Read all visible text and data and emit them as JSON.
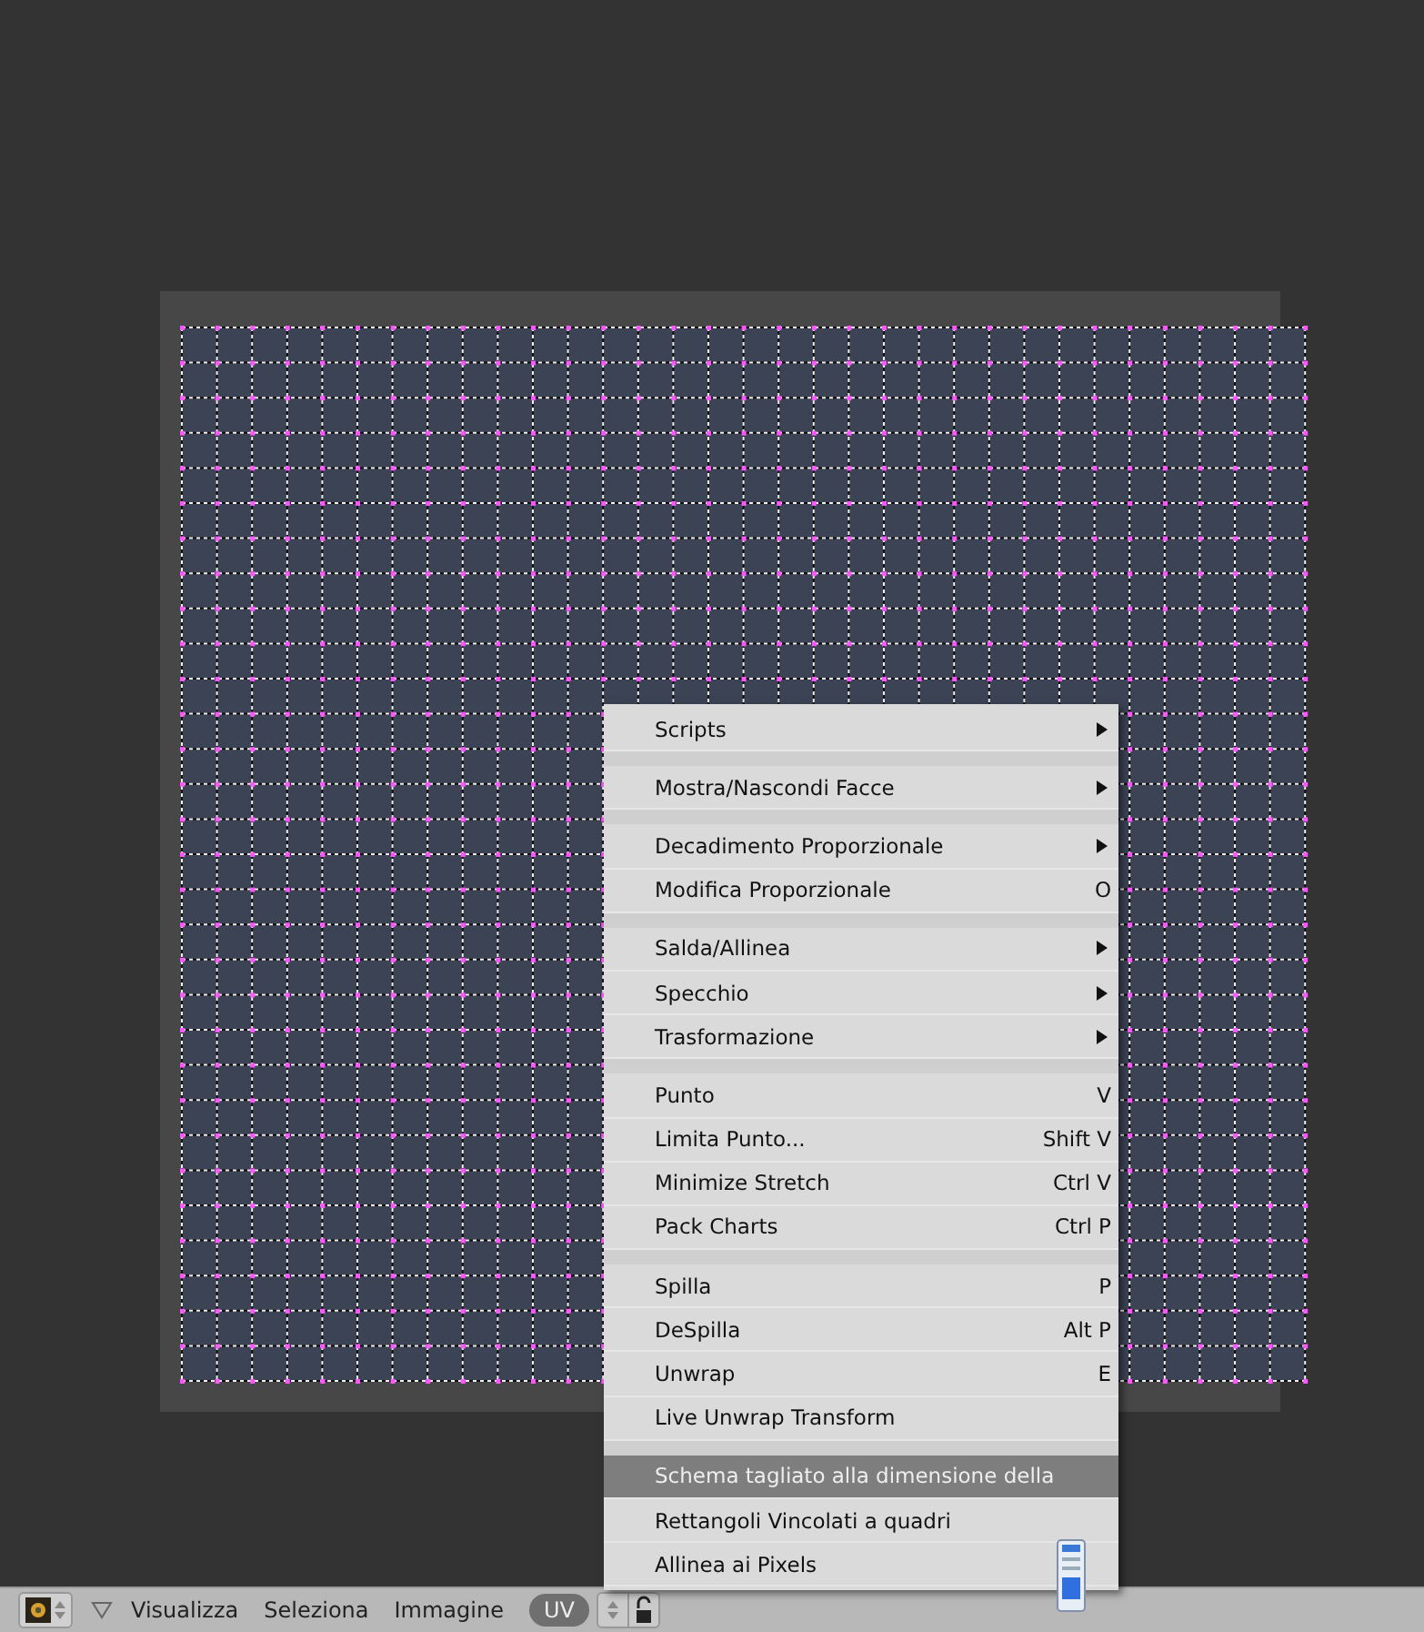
{
  "menu": {
    "groups": [
      [
        {
          "label": "Scripts",
          "kind": "submenu",
          "selected": false
        }
      ],
      [
        {
          "label": "Mostra/Nascondi Facce",
          "kind": "submenu",
          "selected": false
        }
      ],
      [
        {
          "label": "Decadimento Proporzionale",
          "kind": "submenu",
          "selected": false
        },
        {
          "label": "Modifica Proporzionale",
          "kind": "shortcut",
          "shortcut": "O",
          "selected": false
        }
      ],
      [
        {
          "label": "Salda/Allinea",
          "kind": "submenu",
          "selected": false
        },
        {
          "label": "Specchio",
          "kind": "submenu",
          "selected": false
        },
        {
          "label": "Trasformazione",
          "kind": "submenu",
          "selected": false
        }
      ],
      [
        {
          "label": "Punto",
          "kind": "shortcut",
          "shortcut": "V",
          "selected": false
        },
        {
          "label": "Limita Punto...",
          "kind": "shortcut",
          "shortcut": "Shift V",
          "selected": false
        },
        {
          "label": "Minimize Stretch",
          "kind": "shortcut",
          "shortcut": "Ctrl V",
          "selected": false
        },
        {
          "label": "Pack Charts",
          "kind": "shortcut",
          "shortcut": "Ctrl P",
          "selected": false
        }
      ],
      [
        {
          "label": "Spilla",
          "kind": "shortcut",
          "shortcut": "P",
          "selected": false
        },
        {
          "label": "DeSpilla",
          "kind": "shortcut",
          "shortcut": "Alt P",
          "selected": false
        },
        {
          "label": "Unwrap",
          "kind": "shortcut",
          "shortcut": "E",
          "selected": false
        },
        {
          "label": "Live Unwrap Transform",
          "kind": "plain",
          "selected": false
        }
      ],
      [
        {
          "label": "Schema tagliato alla dimensione della",
          "kind": "plain",
          "selected": true
        },
        {
          "label": "Rettangoli Vincolati a quadri",
          "kind": "plain",
          "selected": false
        },
        {
          "label": "Allinea ai Pixels",
          "kind": "plain",
          "selected": false
        }
      ]
    ]
  },
  "header": {
    "menus": [
      {
        "label": "Visualizza",
        "selected": false
      },
      {
        "label": "Seleziona",
        "selected": false
      },
      {
        "label": "Immagine",
        "selected": false
      },
      {
        "label": "UV",
        "selected": true
      }
    ]
  }
}
